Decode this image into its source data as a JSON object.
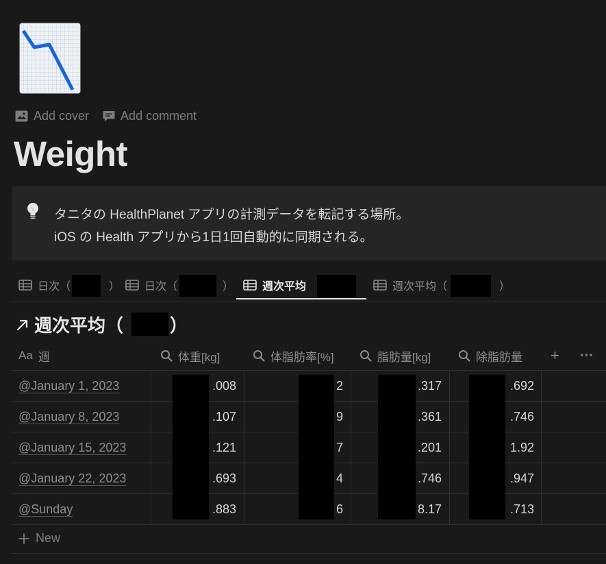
{
  "page": {
    "icon": "chart-decreasing-icon",
    "add_cover": "Add cover",
    "add_comment": "Add comment",
    "title": "Weight"
  },
  "callout": {
    "icon": "lightbulb-icon",
    "line1": "タニタの HealthPlanet アプリの計測データを転記する場所。",
    "line2": "iOS の Health アプリから1日1回自動的に同期される。"
  },
  "tabs": [
    {
      "label": "日次（",
      "close": "）",
      "active": false
    },
    {
      "label": "日次（",
      "close": "）",
      "active": false
    },
    {
      "label": "週次平均",
      "close": "",
      "active": true
    },
    {
      "label": "週次平均（",
      "close": "）",
      "active": false
    }
  ],
  "view": {
    "icon": "arrow-up-right-icon",
    "title_prefix": "週次平均（",
    "title_suffix": "）"
  },
  "table": {
    "columns": [
      {
        "type": "title",
        "icon_text": "Aa",
        "label": "週"
      },
      {
        "type": "formula",
        "icon": "search-icon",
        "label": "体重[kg]"
      },
      {
        "type": "formula",
        "icon": "search-icon",
        "label": "体脂肪率[%]"
      },
      {
        "type": "formula",
        "icon": "search-icon",
        "label": "脂肪量[kg]"
      },
      {
        "type": "formula",
        "icon": "search-icon",
        "label": "除脂肪量"
      }
    ],
    "add_column": "+",
    "more": "···",
    "rows": [
      {
        "week": "@January 1, 2023",
        "weight": ".008",
        "fat_rate": "2",
        "fat_mass": ".317",
        "lean_mass": ".692"
      },
      {
        "week": "@January 8, 2023",
        "weight": ".107",
        "fat_rate": "9",
        "fat_mass": ".361",
        "lean_mass": ".746"
      },
      {
        "week": "@January 15, 2023",
        "weight": ".121",
        "fat_rate": "7",
        "fat_mass": ".201",
        "lean_mass": "1.92"
      },
      {
        "week": "@January 22, 2023",
        "weight": ".693",
        "fat_rate": "4",
        "fat_mass": ".746",
        "lean_mass": ".947"
      },
      {
        "week": "@Sunday",
        "weight": ".883",
        "fat_rate": "6",
        "fat_mass": "8.17",
        "lean_mass": ".713"
      }
    ],
    "new_label": "New"
  },
  "colors": {
    "background": "#191919",
    "callout_bg": "#252525",
    "icon_line": "#1565d8"
  }
}
